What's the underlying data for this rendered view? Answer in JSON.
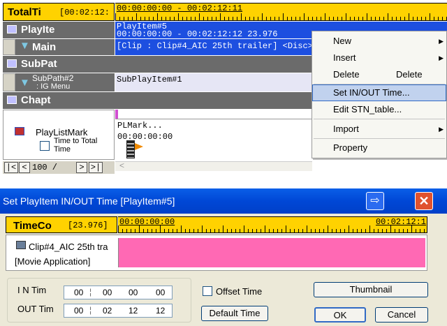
{
  "timeline": {
    "total_label": "TotalTi",
    "total_time": "[00:02:12:",
    "ruler_range": "00:00:00:00 - 00:02:12:11",
    "tracks": {
      "playitem": {
        "label": "PlayIte",
        "content": "PlayItem#5",
        "range": "00:00:00:00 - 00:02:12:12  23.976"
      },
      "main": {
        "label": "Main",
        "clip": "[Clip : Clip#4_AIC 25th trailer] <Disc>"
      },
      "subpath": {
        "label": "SubPat"
      },
      "subpath2": {
        "label": "SubPath#2",
        "sublabel": ": IG Menu",
        "content": "SubPlayItem#1"
      },
      "chapter": {
        "label": "Chapt"
      },
      "playlistmark": {
        "label": "PlayListMark",
        "checkbox_label": "Time to Total Time",
        "mark_label": "PLMark...",
        "mark_time": "00:00:00:00"
      }
    },
    "nav": {
      "first": "|<",
      "prev": "<",
      "page": "100 /",
      "next": ">",
      "last": ">|",
      "scroll_left": "<"
    }
  },
  "context_menu": {
    "items": [
      {
        "label": "New",
        "has_sub": true
      },
      {
        "label": "Insert",
        "has_sub": true
      },
      {
        "label": "Delete",
        "shortcut": "Delete"
      },
      {
        "label": "Set IN/OUT Time...",
        "selected": true
      },
      {
        "label": "Edit STN_table..."
      },
      {
        "label": "Import",
        "has_sub": true
      },
      {
        "label": "Property"
      }
    ]
  },
  "dialog": {
    "title": "Set PlayItem IN/OUT Time [PlayItem#5]",
    "timecode_label": "TimeCo",
    "framerate": "[23.976]",
    "ruler_start": "00:00:00:00",
    "ruler_end": "00:02:12:1",
    "clip_name": "Clip#4_AIC 25th tra",
    "clip_app": "[Movie Application]",
    "in_label": "I N Tim",
    "out_label": "OUT Tim",
    "in_values": [
      "00",
      "00",
      "00",
      "00"
    ],
    "out_values": [
      "00",
      "02",
      "12",
      "12"
    ],
    "offset_label": "Offset Time",
    "default_time": "Default Time",
    "thumbnail": "Thumbnail",
    "ok": "OK",
    "cancel": "Cancel",
    "segment_color": "#ff69b4"
  }
}
